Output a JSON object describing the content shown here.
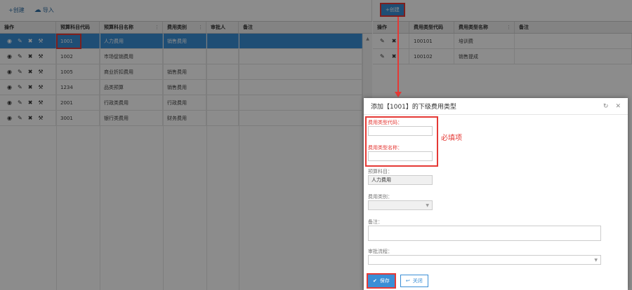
{
  "left": {
    "toolbar": {
      "create_label": "+创建",
      "import_label": "导入"
    },
    "columns": {
      "op": "操作",
      "code": "预算科目代码",
      "name": "预算科目名称",
      "type": "费用类别",
      "approver": "审批人",
      "note": "备注"
    },
    "rows": [
      {
        "code": "1001",
        "name": "人力费用",
        "type": "销售费用"
      },
      {
        "code": "1002",
        "name": "市场促销费用",
        "type": ""
      },
      {
        "code": "1005",
        "name": "商业折扣费用",
        "type": "销售费用"
      },
      {
        "code": "1234",
        "name": "品类预算",
        "type": "销售费用"
      },
      {
        "code": "2001",
        "name": "行政类费用",
        "type": "行政费用"
      },
      {
        "code": "3001",
        "name": "银行类费用",
        "type": "财务费用"
      }
    ]
  },
  "right": {
    "toolbar": {
      "create_label": "+创建"
    },
    "columns": {
      "op": "操作",
      "code": "费用类型代码",
      "name": "费用类型名称",
      "note": "备注"
    },
    "rows": [
      {
        "code": "100101",
        "name": "培训费"
      },
      {
        "code": "100102",
        "name": "销售提成"
      }
    ]
  },
  "modal": {
    "title": "添加【1001】的下级费用类型",
    "fields": {
      "type_code_label": "费用类型代码：",
      "type_name_label": "费用类型名称：",
      "budget_subject_label": "预算科目：",
      "budget_subject_value": "人力费用",
      "expense_category_label": "费用类别：",
      "note_label": "备注：",
      "approval_flow_label": "审批流程："
    },
    "required_note": "必填项",
    "save_label": "保存",
    "close_label": "关闭"
  },
  "colors": {
    "accent": "#3a8ed6",
    "annotation": "#e53935"
  }
}
